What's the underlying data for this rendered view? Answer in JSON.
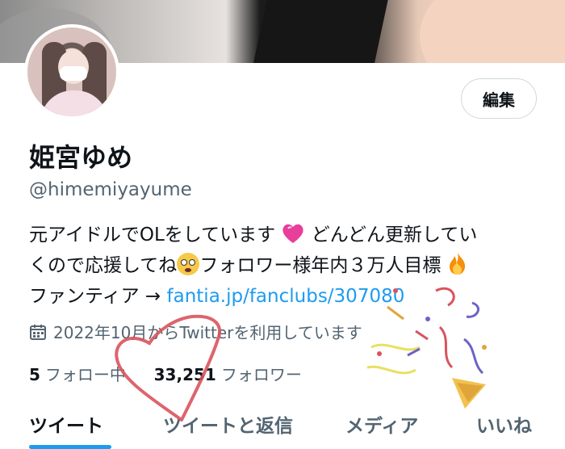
{
  "profile": {
    "name": "姫宮ゆめ",
    "handle": "@himemiyayume",
    "edit_label": "編集",
    "bio": {
      "line1_a": "元アイドルでOLをしています",
      "line1_b": " どんどん更新してい",
      "line2_a": "くので応援してね",
      "line2_b": "フォロワー様年内３万人目標",
      "line3_prefix": "ファンティア → ",
      "link": "fantia.jp/fanclubs/307080"
    },
    "joined": "2022年10月からTwitterを利用しています",
    "following_count": "5",
    "following_label": "フォロー中",
    "followers_count": "33,251",
    "followers_label": "フォロワー"
  },
  "tabs": [
    {
      "label": "ツイート",
      "active": true
    },
    {
      "label": "ツイートと返信",
      "active": false
    },
    {
      "label": "メディア",
      "active": false
    },
    {
      "label": "いいね",
      "active": false
    }
  ],
  "icons": {
    "heart_emoji": "pink-heart-icon",
    "flushed_emoji": "flushed-face-icon",
    "fire_emoji": "fire-icon",
    "calendar": "calendar-icon",
    "overlay_heart": "drawn-heart-sticker",
    "overlay_popper": "party-popper-sticker"
  },
  "colors": {
    "link": "#1d9bf0",
    "secondary_text": "#536471",
    "accent": "#1d9bf0"
  }
}
